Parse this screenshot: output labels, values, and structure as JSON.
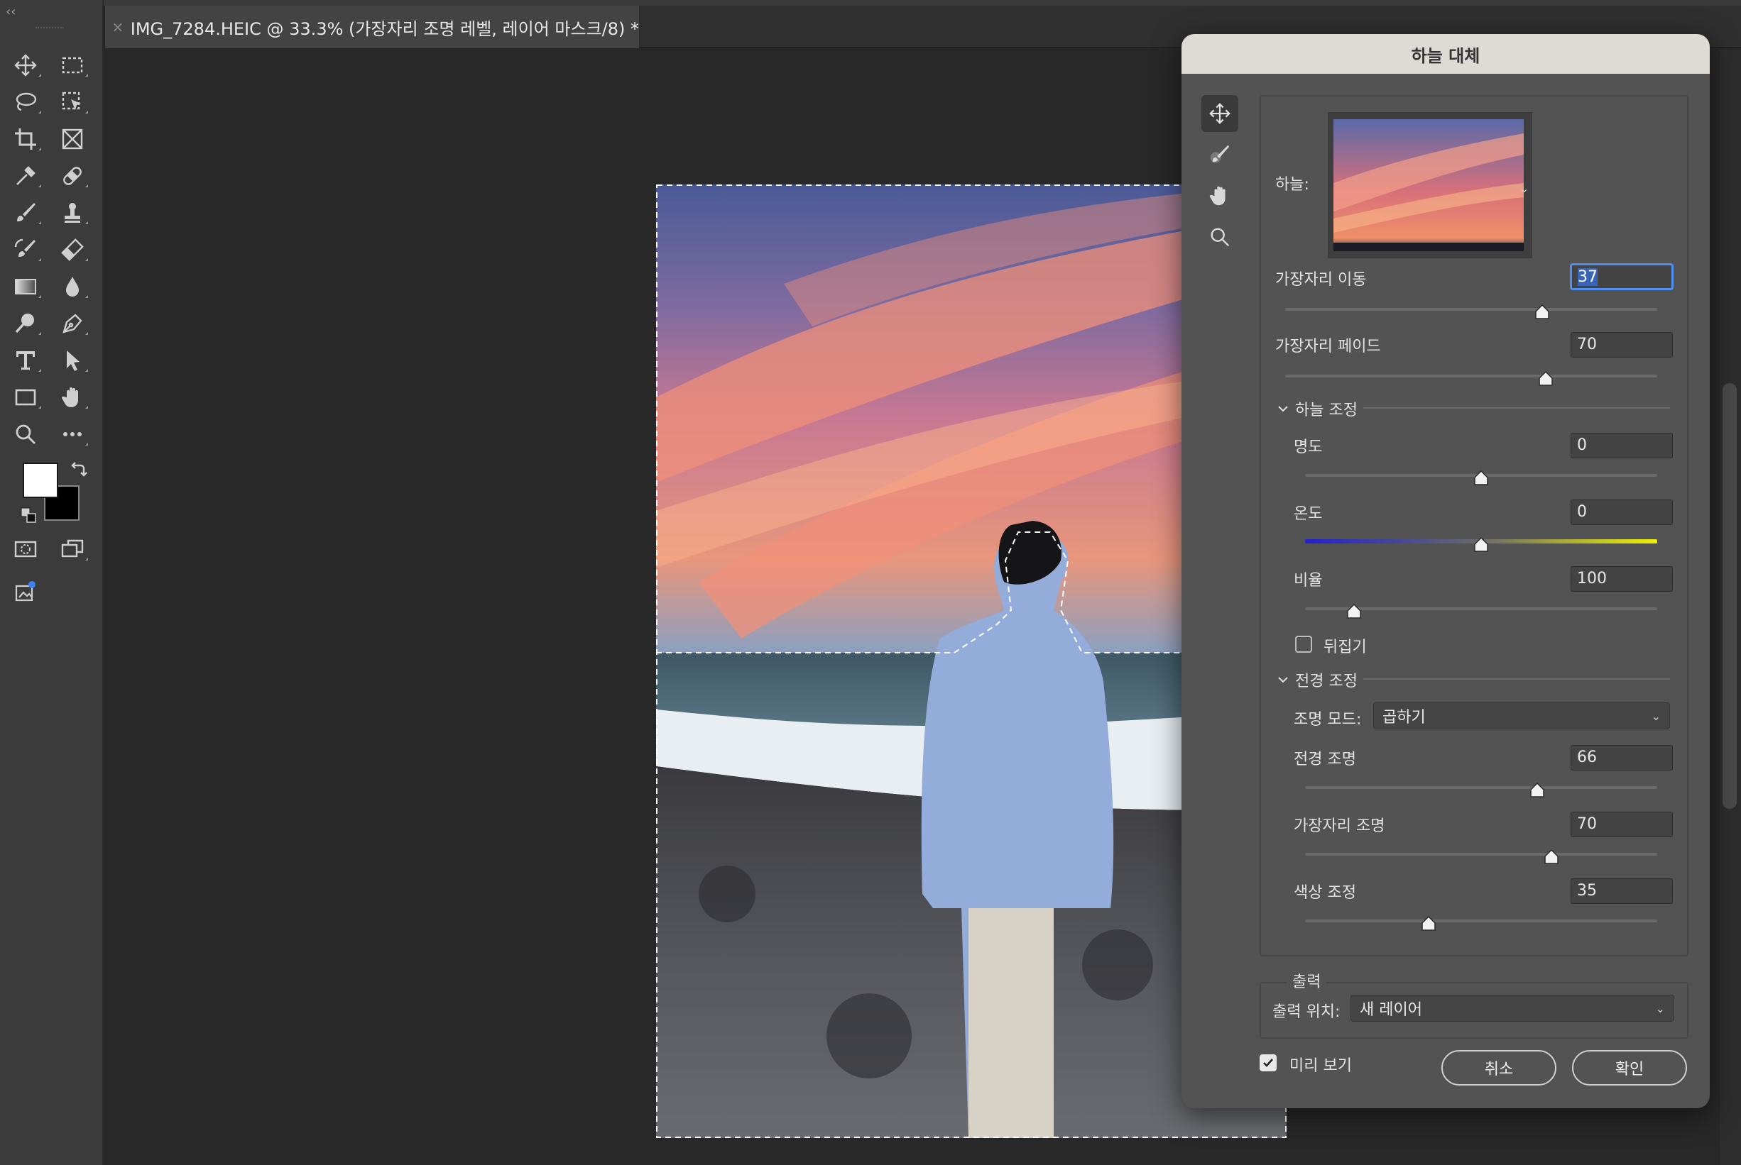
{
  "document": {
    "tab_title": "IMG_7284.HEIC @ 33.3% (가장자리 조명 레벨, 레이어 마스크/8) *",
    "close_glyph": "×"
  },
  "toolbar": {
    "collapse_glyph": "‹‹",
    "tools": [
      "move-tool",
      "marquee-tool",
      "lasso-tool",
      "object-select-tool",
      "crop-tool",
      "frame-tool",
      "eyedropper-tool",
      "healing-tool",
      "brush-tool",
      "stamp-tool",
      "history-brush-tool",
      "eraser-tool",
      "gradient-tool",
      "blur-tool",
      "dodge-tool",
      "pen-tool",
      "type-tool",
      "path-select-tool",
      "rectangle-tool",
      "hand-tool",
      "zoom-tool",
      "more-tools",
      "quick-mask",
      "screen-mode",
      "generative-fill"
    ],
    "foreground_color": "#ffffff",
    "background_color": "#000000"
  },
  "dialog": {
    "title": "하늘 대체",
    "tools": [
      "move-sky-tool",
      "sky-brush-tool",
      "hand-tool",
      "zoom-tool"
    ],
    "sky_label": "하늘:",
    "fields": {
      "shift_edge": {
        "label": "가장자리 이동",
        "value": "37",
        "level": 0.69
      },
      "fade_edge": {
        "label": "가장자리 페이드",
        "value": "70",
        "level": 0.7
      },
      "brightness": {
        "label": "명도",
        "value": "0",
        "level": 0.5
      },
      "temperature": {
        "label": "온도",
        "value": "0",
        "level": 0.5
      },
      "scale": {
        "label": "비율",
        "value": "100",
        "level": 0.14
      },
      "foreground_lighting": {
        "label": "전경 조명",
        "value": "66",
        "level": 0.66
      },
      "edge_lighting": {
        "label": "가장자리 조명",
        "value": "70",
        "level": 0.7
      },
      "color_adjust": {
        "label": "색상 조정",
        "value": "35",
        "level": 0.35
      }
    },
    "sky_adjust_section": "하늘 조정",
    "flip_label": "뒤집기",
    "flip_checked": false,
    "foreground_section": "전경 조정",
    "lighting_mode_label": "조명 모드:",
    "lighting_mode_value": "곱하기",
    "output_section": "출력",
    "output_to_label": "출력 위치:",
    "output_to_value": "새 레이어",
    "preview_label": "미리 보기",
    "preview_checked": true,
    "cancel_label": "취소",
    "ok_label": "확인"
  },
  "colors": {
    "accent": "#4d8ff2",
    "temperature_cold": "#2020d0",
    "temperature_warm": "#f0f000"
  }
}
